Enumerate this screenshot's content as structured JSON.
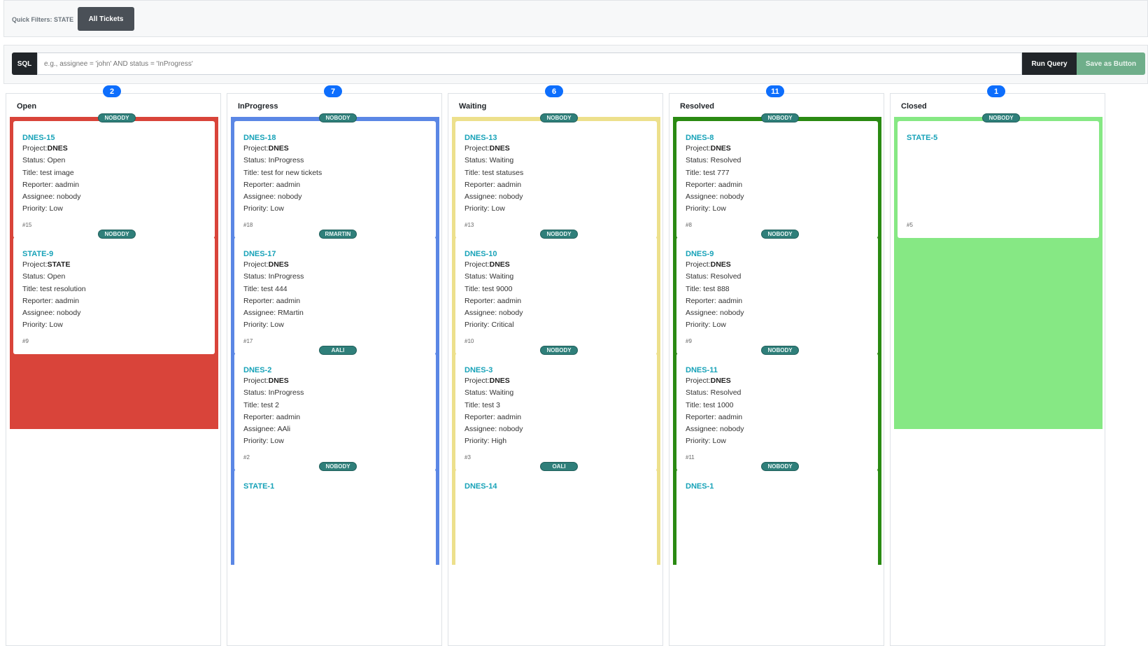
{
  "filters": {
    "label": "Quick Filters: STATE",
    "button": "All Tickets"
  },
  "sql": {
    "tag": "SQL",
    "placeholder": "e.g., assignee = 'john' AND status = 'InProgress'",
    "run_label": "Run Query",
    "save_label": "Save as Button"
  },
  "labels": {
    "project": "Project:",
    "status": "Status: ",
    "title": "Title: ",
    "reporter": "Reporter: ",
    "assignee": "Assignee: ",
    "priority": "Priority: "
  },
  "columns": [
    {
      "name": "Open",
      "count": "2",
      "color": "#d9443a",
      "cards": [
        {
          "tag": "NOBODY",
          "key": "DNES-15",
          "project": "DNES",
          "status": "Open",
          "title": "test image",
          "reporter": "aadmin",
          "assignee": "nobody",
          "priority": "Low",
          "num": "#15"
        },
        {
          "tag": "NOBODY",
          "key": "STATE-9",
          "project": "STATE",
          "status": "Open",
          "title": "test resolution",
          "reporter": "aadmin",
          "assignee": "nobody",
          "priority": "Low",
          "num": "#9"
        }
      ]
    },
    {
      "name": "InProgress",
      "count": "7",
      "color": "#5b87e5",
      "cards": [
        {
          "tag": "NOBODY",
          "key": "DNES-18",
          "project": "DNES",
          "status": "InProgress",
          "title": "test for new tickets",
          "reporter": "aadmin",
          "assignee": "nobody",
          "priority": "Low",
          "num": "#18"
        },
        {
          "tag": "RMARTIN",
          "key": "DNES-17",
          "project": "DNES",
          "status": "InProgress",
          "title": "test 444",
          "reporter": "aadmin",
          "assignee": "RMartin",
          "priority": "Low",
          "num": "#17"
        },
        {
          "tag": "AALI",
          "key": "DNES-2",
          "project": "DNES",
          "status": "InProgress",
          "title": "test 2",
          "reporter": "aadmin",
          "assignee": "AAli",
          "priority": "Low",
          "num": "#2"
        },
        {
          "tag": "NOBODY",
          "key": "STATE-1",
          "project": "",
          "status": "",
          "title": "",
          "reporter": "",
          "assignee": "",
          "priority": "",
          "num": ""
        }
      ]
    },
    {
      "name": "Waiting",
      "count": "6",
      "color": "#ede08c",
      "cards": [
        {
          "tag": "NOBODY",
          "key": "DNES-13",
          "project": "DNES",
          "status": "Waiting",
          "title": "test statuses",
          "reporter": "aadmin",
          "assignee": "nobody",
          "priority": "Low",
          "num": "#13"
        },
        {
          "tag": "NOBODY",
          "key": "DNES-10",
          "project": "DNES",
          "status": "Waiting",
          "title": "test 9000",
          "reporter": "aadmin",
          "assignee": "nobody",
          "priority": "Critical",
          "num": "#10"
        },
        {
          "tag": "NOBODY",
          "key": "DNES-3",
          "project": "DNES",
          "status": "Waiting",
          "title": "test 3",
          "reporter": "aadmin",
          "assignee": "nobody",
          "priority": "High",
          "num": "#3"
        },
        {
          "tag": "OALI",
          "key": "DNES-14",
          "project": "",
          "status": "",
          "title": "",
          "reporter": "",
          "assignee": "",
          "priority": "",
          "num": ""
        }
      ]
    },
    {
      "name": "Resolved",
      "count": "11",
      "color": "#2a8a12",
      "cards": [
        {
          "tag": "NOBODY",
          "key": "DNES-8",
          "project": "DNES",
          "status": "Resolved",
          "title": "test 777",
          "reporter": "aadmin",
          "assignee": "nobody",
          "priority": "Low",
          "num": "#8"
        },
        {
          "tag": "NOBODY",
          "key": "DNES-9",
          "project": "DNES",
          "status": "Resolved",
          "title": "test 888",
          "reporter": "aadmin",
          "assignee": "nobody",
          "priority": "Low",
          "num": "#9"
        },
        {
          "tag": "NOBODY",
          "key": "DNES-11",
          "project": "DNES",
          "status": "Resolved",
          "title": "test 1000",
          "reporter": "aadmin",
          "assignee": "nobody",
          "priority": "Low",
          "num": "#11"
        },
        {
          "tag": "NOBODY",
          "key": "DNES-1",
          "project": "",
          "status": "",
          "title": "",
          "reporter": "",
          "assignee": "",
          "priority": "",
          "num": ""
        }
      ]
    },
    {
      "name": "Closed",
      "count": "1",
      "color": "#86e884",
      "cards": [
        {
          "tag": "NOBODY",
          "key": "STATE-5",
          "project": "",
          "status": "",
          "title": "",
          "reporter": "",
          "assignee": "",
          "priority": "",
          "num": "#5"
        }
      ]
    }
  ]
}
